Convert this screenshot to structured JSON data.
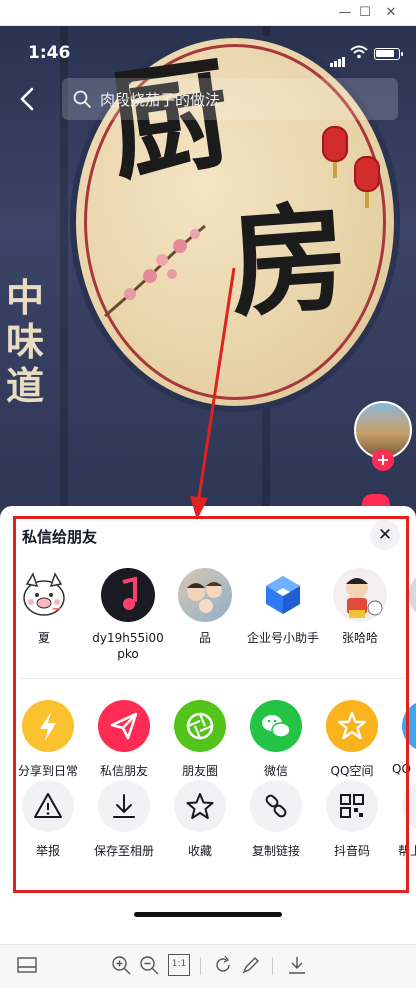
{
  "status_bar": {
    "time": "1:46",
    "battery_level": 0.9
  },
  "search": {
    "query": "肉段烧茄子的做法"
  },
  "video": {
    "banner_chars": [
      "厨",
      "房"
    ],
    "side_chars": [
      "中",
      "味",
      "道"
    ]
  },
  "share_sheet": {
    "title": "私信给朋友",
    "friends": [
      {
        "name": "夏",
        "avatar": "pig-avatar"
      },
      {
        "name": "dy19h55i00pko",
        "avatar": "music-note-avatar"
      },
      {
        "name": "品",
        "avatar": "family-photo-avatar"
      },
      {
        "name": "企业号小助手",
        "avatar": "cube-logo-avatar"
      },
      {
        "name": "张哈哈",
        "avatar": "cartoon-boy-avatar"
      }
    ],
    "share_row": [
      {
        "label": "分享到日常",
        "icon": "lightning-icon",
        "color": "#f9c22e"
      },
      {
        "label": "私信朋友",
        "icon": "paper-plane-icon",
        "color": "#fe2c55"
      },
      {
        "label": "朋友圈",
        "icon": "aperture-icon",
        "color": "#52c41a"
      },
      {
        "label": "微信",
        "icon": "wechat-icon",
        "color": "#23c343"
      },
      {
        "label": "QQ空间",
        "icon": "star-icon",
        "color": "#f8b31d"
      },
      {
        "label": "QQ",
        "icon": "qq-icon",
        "color": "#3ca8f0"
      }
    ],
    "action_row": [
      {
        "label": "举报",
        "icon": "warning-icon"
      },
      {
        "label": "保存至相册",
        "icon": "download-icon"
      },
      {
        "label": "收藏",
        "icon": "star-outline-icon"
      },
      {
        "label": "复制链接",
        "icon": "link-icon"
      },
      {
        "label": "抖音码",
        "icon": "qr-code-icon"
      },
      {
        "label": "帮上",
        "icon": "more-icon"
      }
    ]
  },
  "toolbar": {
    "icons": [
      "layout-icon",
      "zoom-in-icon",
      "zoom-out-icon",
      "actual-size-icon",
      "rotate-icon",
      "edit-icon",
      "download-icon"
    ],
    "actual_size_label": "1:1"
  },
  "colors": {
    "accent_red": "#fe2c55",
    "annotation_red": "#e12020"
  }
}
